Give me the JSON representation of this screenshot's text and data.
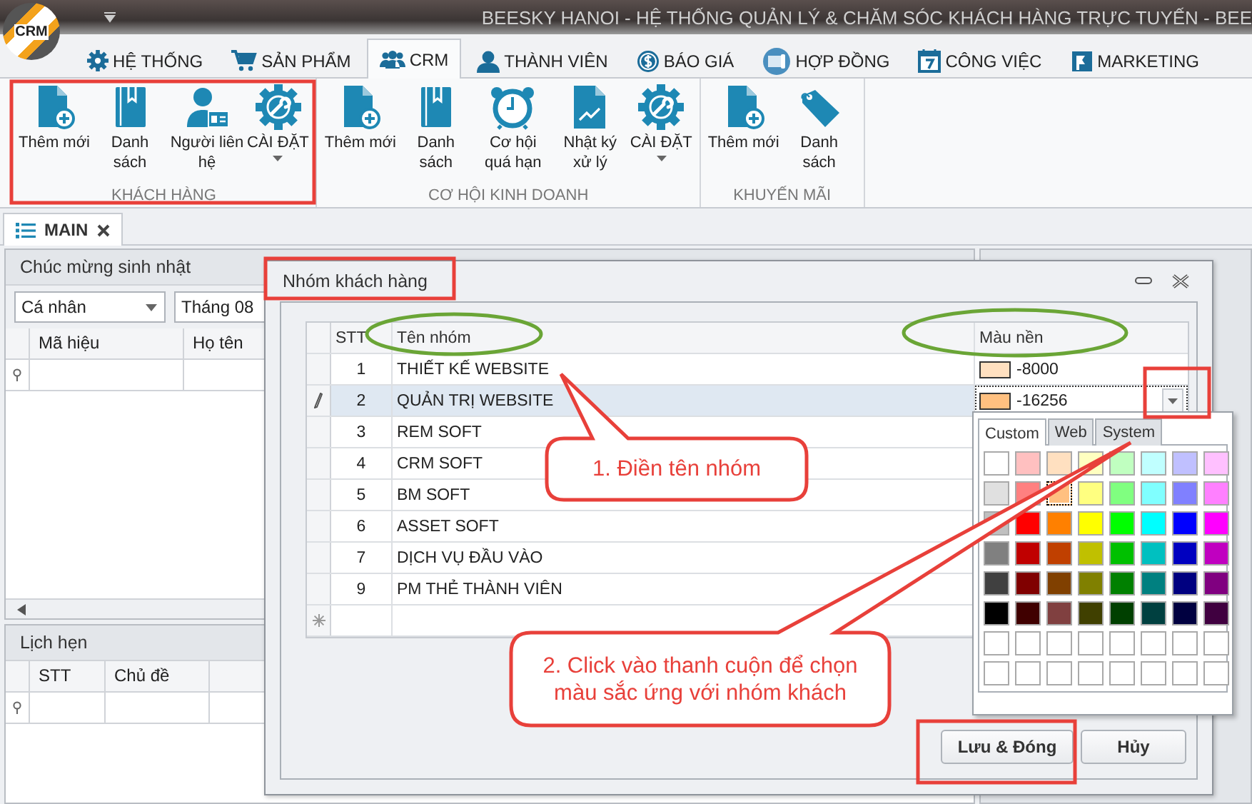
{
  "window": {
    "title": "BEESKY HANOI - HỆ THỐNG QUẢN LÝ & CHĂM SÓC KHÁCH HÀNG TRỰC TUYẾN - BEE",
    "logo": "CRM"
  },
  "ribbon": {
    "tabs": [
      {
        "label": "HỆ THỐNG",
        "selected": false
      },
      {
        "label": "SẢN PHẨM",
        "selected": false
      },
      {
        "label": "CRM",
        "selected": true
      },
      {
        "label": "THÀNH VIÊN",
        "selected": false
      },
      {
        "label": "BÁO GIÁ",
        "selected": false
      },
      {
        "label": "HỢP ĐỒNG",
        "selected": false
      },
      {
        "label": "CÔNG VIỆC",
        "selected": false
      },
      {
        "label": "MARKETING",
        "selected": false
      }
    ],
    "groups": [
      {
        "title": "KHÁCH HÀNG",
        "buttons": [
          {
            "label": "Thêm mới",
            "kind": "button"
          },
          {
            "label": "Danh sách",
            "kind": "button"
          },
          {
            "label": "Người liên hệ",
            "kind": "button"
          },
          {
            "label": "CÀI ĐẶT",
            "kind": "dropdown"
          }
        ]
      },
      {
        "title": "CƠ HỘI KINH DOANH",
        "buttons": [
          {
            "label": "Thêm mới",
            "kind": "button"
          },
          {
            "label": "Danh sách",
            "kind": "button"
          },
          {
            "label": "Cơ hội quá hạn",
            "kind": "button"
          },
          {
            "label": "Nhật ký xử lý",
            "kind": "button"
          },
          {
            "label": "CÀI ĐẶT",
            "kind": "dropdown"
          }
        ]
      },
      {
        "title": "KHUYẾN MÃI",
        "buttons": [
          {
            "label": "Thêm mới",
            "kind": "button"
          },
          {
            "label": "Danh sách",
            "kind": "button"
          }
        ]
      }
    ]
  },
  "document_tabs": [
    {
      "label": "MAIN",
      "selected": true
    }
  ],
  "birthday_panel": {
    "title": "Chúc mừng sinh nhật",
    "filters": [
      {
        "value": "Cá nhân"
      },
      {
        "value": "Tháng 08"
      }
    ],
    "columns": [
      "Mã hiệu",
      "Họ tên"
    ]
  },
  "appointments_panel": {
    "title": "Lịch hẹn",
    "columns": [
      "STT",
      "Chủ đề"
    ]
  },
  "dialog": {
    "title": "Nhóm khách hàng",
    "columns": [
      "STT",
      "Tên nhóm",
      "Màu nền"
    ],
    "rows": [
      {
        "stt": "1",
        "name": "THIẾT KẾ WEBSITE",
        "color": "#ffe0c0",
        "color_value": "-8000",
        "selected": false
      },
      {
        "stt": "2",
        "name": "QUẢN TRỊ WEBSITE",
        "color": "#ffc080",
        "color_value": "-16256",
        "selected": true
      },
      {
        "stt": "3",
        "name": "REM SOFT",
        "selected": false
      },
      {
        "stt": "4",
        "name": "CRM SOFT",
        "selected": false
      },
      {
        "stt": "5",
        "name": "BM SOFT",
        "selected": false
      },
      {
        "stt": "6",
        "name": "ASSET SOFT",
        "selected": false
      },
      {
        "stt": "7",
        "name": "DỊCH VỤ ĐẦU VÀO",
        "selected": false
      },
      {
        "stt": "9",
        "name": "PM THẺ THÀNH VIÊN",
        "selected": false
      }
    ],
    "buttons": [
      "Lưu & Đóng",
      "Hủy"
    ]
  },
  "color_picker": {
    "tabs": [
      {
        "label": "Custom",
        "selected": true
      },
      {
        "label": "Web",
        "selected": false
      },
      {
        "label": "System",
        "selected": false
      }
    ],
    "swatches": [
      {
        "kind": "color",
        "color": "#ffffff",
        "selected": false
      },
      {
        "kind": "color",
        "color": "#ffc0c0",
        "selected": false
      },
      {
        "kind": "color",
        "color": "#ffe0c0",
        "selected": false
      },
      {
        "kind": "color",
        "color": "#ffffc0",
        "selected": false
      },
      {
        "kind": "color",
        "color": "#c0ffc0",
        "selected": false
      },
      {
        "kind": "color",
        "color": "#c0ffff",
        "selected": false
      },
      {
        "kind": "color",
        "color": "#c0c0ff",
        "selected": false
      },
      {
        "kind": "color",
        "color": "#ffc0ff",
        "selected": false
      },
      {
        "kind": "color",
        "color": "#e0e0e0",
        "selected": false
      },
      {
        "kind": "color",
        "color": "#ff8080",
        "selected": false
      },
      {
        "kind": "color",
        "color": "#ffc080",
        "selected": true
      },
      {
        "kind": "color",
        "color": "#ffff80",
        "selected": false
      },
      {
        "kind": "color",
        "color": "#80ff80",
        "selected": false
      },
      {
        "kind": "color",
        "color": "#80ffff",
        "selected": false
      },
      {
        "kind": "color",
        "color": "#8080ff",
        "selected": false
      },
      {
        "kind": "color",
        "color": "#ff80ff",
        "selected": false
      },
      {
        "kind": "color",
        "color": "#c0c0c0",
        "selected": false
      },
      {
        "kind": "color",
        "color": "#ff0000",
        "selected": false
      },
      {
        "kind": "color",
        "color": "#ff8000",
        "selected": false
      },
      {
        "kind": "color",
        "color": "#ffff00",
        "selected": false
      },
      {
        "kind": "color",
        "color": "#00ff00",
        "selected": false
      },
      {
        "kind": "color",
        "color": "#00ffff",
        "selected": false
      },
      {
        "kind": "color",
        "color": "#0000ff",
        "selected": false
      },
      {
        "kind": "color",
        "color": "#ff00ff",
        "selected": false
      },
      {
        "kind": "color",
        "color": "#808080",
        "selected": false
      },
      {
        "kind": "color",
        "color": "#c00000",
        "selected": false
      },
      {
        "kind": "color",
        "color": "#c04000",
        "selected": false
      },
      {
        "kind": "color",
        "color": "#c0c000",
        "selected": false
      },
      {
        "kind": "color",
        "color": "#00c000",
        "selected": false
      },
      {
        "kind": "color",
        "color": "#00c0c0",
        "selected": false
      },
      {
        "kind": "color",
        "color": "#0000c0",
        "selected": false
      },
      {
        "kind": "color",
        "color": "#c000c0",
        "selected": false
      },
      {
        "kind": "color",
        "color": "#404040",
        "selected": false
      },
      {
        "kind": "color",
        "color": "#800000",
        "selected": false
      },
      {
        "kind": "color",
        "color": "#804000",
        "selected": false
      },
      {
        "kind": "color",
        "color": "#808000",
        "selected": false
      },
      {
        "kind": "color",
        "color": "#008000",
        "selected": false
      },
      {
        "kind": "color",
        "color": "#008080",
        "selected": false
      },
      {
        "kind": "color",
        "color": "#000080",
        "selected": false
      },
      {
        "kind": "color",
        "color": "#800080",
        "selected": false
      },
      {
        "kind": "color",
        "color": "#000000",
        "selected": false
      },
      {
        "kind": "color",
        "color": "#400000",
        "selected": false
      },
      {
        "kind": "color",
        "color": "#804040",
        "selected": false
      },
      {
        "kind": "color",
        "color": "#404000",
        "selected": false
      },
      {
        "kind": "color",
        "color": "#004000",
        "selected": false
      },
      {
        "kind": "color",
        "color": "#004040",
        "selected": false
      },
      {
        "kind": "color",
        "color": "#000040",
        "selected": false
      },
      {
        "kind": "color",
        "color": "#400040",
        "selected": false
      },
      {
        "kind": "empty",
        "selected": false
      },
      {
        "kind": "empty",
        "selected": false
      },
      {
        "kind": "empty",
        "selected": false
      },
      {
        "kind": "empty",
        "selected": false
      },
      {
        "kind": "empty",
        "selected": false
      },
      {
        "kind": "empty",
        "selected": false
      },
      {
        "kind": "empty",
        "selected": false
      },
      {
        "kind": "empty",
        "selected": false
      },
      {
        "kind": "empty",
        "selected": false
      },
      {
        "kind": "empty",
        "selected": false
      },
      {
        "kind": "empty",
        "selected": false
      },
      {
        "kind": "empty",
        "selected": false
      },
      {
        "kind": "empty",
        "selected": false
      },
      {
        "kind": "empty",
        "selected": false
      },
      {
        "kind": "empty",
        "selected": false
      },
      {
        "kind": "empty",
        "selected": false
      }
    ]
  },
  "callouts": [
    {
      "text": "1. Điền tên nhóm"
    },
    {
      "text": "2. Click vào thanh cuộn để chọn màu sắc ứng với nhóm khách"
    }
  ]
}
